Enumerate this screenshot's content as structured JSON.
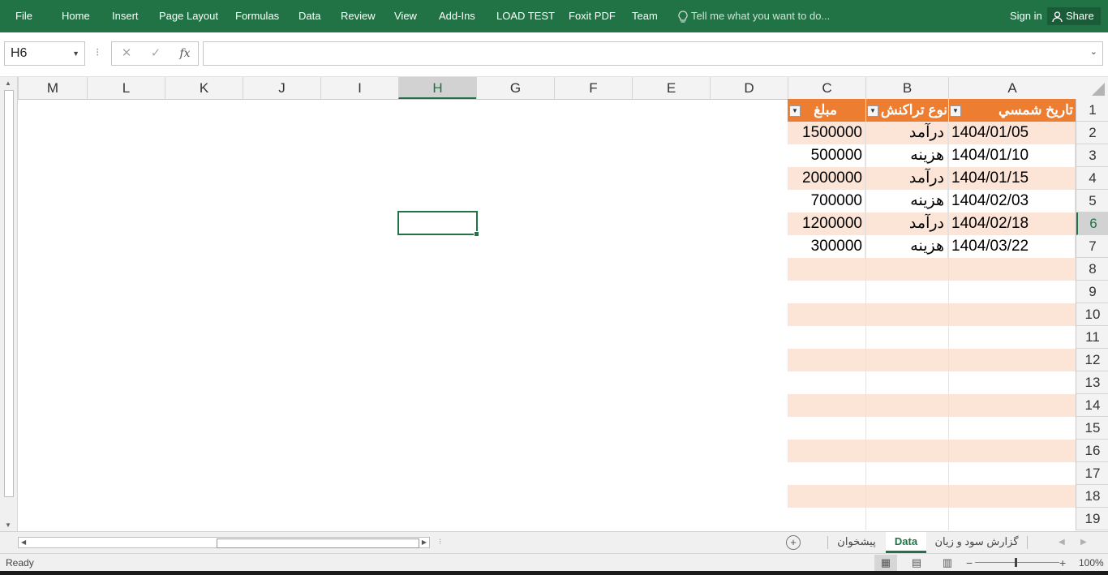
{
  "ribbon": {
    "tabs": [
      "File",
      "Home",
      "Insert",
      "Page Layout",
      "Formulas",
      "Data",
      "Review",
      "View",
      "Add-Ins",
      "LOAD TEST",
      "Foxit PDF",
      "Team"
    ],
    "tell_me": "Tell me what you want to do...",
    "sign_in": "Sign in",
    "share": "Share",
    "color": "#217346"
  },
  "formula_bar": {
    "name_box": "H6",
    "cancel_icon": "✕",
    "enter_icon": "✓",
    "fx_label": "fx",
    "formula": ""
  },
  "grid": {
    "columns": [
      "A",
      "B",
      "C",
      "D",
      "E",
      "F",
      "G",
      "H",
      "I",
      "J",
      "K",
      "L",
      "M"
    ],
    "selected_column": "H",
    "rows": [
      "1",
      "2",
      "3",
      "4",
      "5",
      "6",
      "7",
      "8",
      "9",
      "10",
      "11",
      "12",
      "13",
      "14",
      "15",
      "16",
      "17",
      "18",
      "19"
    ],
    "selected_row": "6",
    "active_cell": "H6"
  },
  "table": {
    "headers": [
      "تاريخ شمسي",
      "نوع تراکنش",
      "مبلغ"
    ],
    "rows": [
      [
        "1404/01/05",
        "درآمد",
        "1500000"
      ],
      [
        "1404/01/10",
        "هزینه",
        "500000"
      ],
      [
        "1404/01/15",
        "درآمد",
        "2000000"
      ],
      [
        "1404/02/03",
        "هزینه",
        "700000"
      ],
      [
        "1404/02/18",
        "درآمد",
        "1200000"
      ],
      [
        "1404/03/22",
        "هزینه",
        "300000"
      ]
    ],
    "header_color": "#ED7D31",
    "band_color": "#FCE4D6"
  },
  "sheets": {
    "tabs": [
      "گزارش سود و زيان",
      "Data",
      "پيشخوان"
    ],
    "active": "Data"
  },
  "status": {
    "ready": "Ready",
    "zoom": "100%"
  }
}
